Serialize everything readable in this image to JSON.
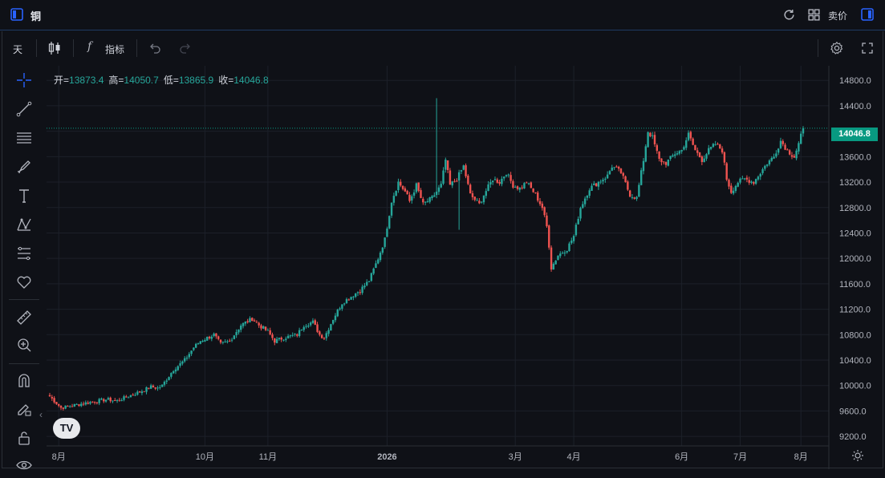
{
  "header": {
    "title": "铜",
    "sell_label": "卖价"
  },
  "toolbar": {
    "interval": "天",
    "indicators_label": "指标",
    "fx_symbol": "f"
  },
  "left_tools": [
    "crosshair-icon",
    "trend-line-icon",
    "horizontal-lines-icon",
    "brush-icon",
    "text-icon",
    "pattern-icon",
    "fib-icon",
    "heart-icon",
    "ruler-icon",
    "zoom-icon",
    "magnet-icon",
    "lock-pencil-icon",
    "lock-icon",
    "eye-icon"
  ],
  "legend": {
    "open_label": "开=",
    "open": "13873.4",
    "high_label": "高=",
    "high": "14050.7",
    "low_label": "低=",
    "low": "13865.9",
    "close_label": "收=",
    "close": "14046.8"
  },
  "colors": {
    "up": "#26a69a",
    "down": "#ef5350",
    "accent": "#2962ff",
    "last_price": "#089981"
  },
  "chart_data": {
    "type": "candlestick",
    "last_price_label": "14046.8",
    "y_ticks": [
      "14800.0",
      "14400.0",
      "14000.0",
      "13600.0",
      "13200.0",
      "12800.0",
      "12400.0",
      "12000.0",
      "11600.0",
      "11200.0",
      "10800.0",
      "10400.0",
      "10000.0",
      "9600.0",
      "9200.0"
    ],
    "y_tick_values": [
      14800,
      14400,
      14000,
      13600,
      13200,
      12800,
      12400,
      12000,
      11600,
      11200,
      10800,
      10400,
      10000,
      9600,
      9200
    ],
    "ylim": [
      9050,
      15030
    ],
    "x_ticks": [
      "8月",
      "10月",
      "11月",
      "2026",
      "3月",
      "4月",
      "6月",
      "7月",
      "8月"
    ],
    "x_tick_index": [
      4,
      69,
      97,
      150,
      207,
      233,
      281,
      307,
      334
    ],
    "anchors": [
      [
        0,
        9830
      ],
      [
        5,
        9650
      ],
      [
        15,
        9720
      ],
      [
        25,
        9780
      ],
      [
        30,
        9760
      ],
      [
        40,
        9900
      ],
      [
        45,
        9980
      ],
      [
        48,
        9960
      ],
      [
        50,
        10000
      ],
      [
        55,
        10250
      ],
      [
        60,
        10400
      ],
      [
        64,
        10600
      ],
      [
        67,
        10700
      ],
      [
        70,
        10750
      ],
      [
        73,
        10800
      ],
      [
        76,
        10650
      ],
      [
        80,
        10700
      ],
      [
        85,
        10950
      ],
      [
        90,
        11050
      ],
      [
        93,
        10950
      ],
      [
        97,
        10850
      ],
      [
        100,
        10700
      ],
      [
        104,
        10750
      ],
      [
        110,
        10800
      ],
      [
        113,
        10950
      ],
      [
        117,
        11000
      ],
      [
        120,
        10800
      ],
      [
        122,
        10750
      ],
      [
        126,
        11050
      ],
      [
        130,
        11300
      ],
      [
        134,
        11400
      ],
      [
        138,
        11500
      ],
      [
        142,
        11650
      ],
      [
        146,
        12000
      ],
      [
        149,
        12300
      ],
      [
        152,
        12900
      ],
      [
        155,
        13200
      ],
      [
        158,
        13050
      ],
      [
        160,
        12900
      ],
      [
        163,
        13150
      ],
      [
        166,
        12850
      ],
      [
        170,
        12950
      ],
      [
        174,
        13150
      ],
      [
        176,
        13550
      ],
      [
        178,
        13150
      ],
      [
        181,
        13250
      ],
      [
        184,
        13450
      ],
      [
        187,
        13000
      ],
      [
        191,
        12850
      ],
      [
        193,
        13000
      ],
      [
        197,
        13250
      ],
      [
        200,
        13200
      ],
      [
        203,
        13350
      ],
      [
        206,
        13150
      ],
      [
        209,
        13100
      ],
      [
        212,
        13200
      ],
      [
        216,
        13000
      ],
      [
        219,
        12800
      ],
      [
        221,
        12500
      ],
      [
        222,
        12200
      ],
      [
        223,
        11850
      ],
      [
        226,
        12050
      ],
      [
        230,
        12150
      ],
      [
        233,
        12350
      ],
      [
        236,
        12800
      ],
      [
        240,
        13100
      ],
      [
        244,
        13200
      ],
      [
        248,
        13300
      ],
      [
        250,
        13450
      ],
      [
        254,
        13350
      ],
      [
        258,
        13000
      ],
      [
        261,
        12950
      ],
      [
        264,
        13550
      ],
      [
        266,
        14000
      ],
      [
        268,
        13900
      ],
      [
        271,
        13550
      ],
      [
        274,
        13500
      ],
      [
        278,
        13650
      ],
      [
        281,
        13700
      ],
      [
        284,
        13950
      ],
      [
        287,
        13700
      ],
      [
        290,
        13550
      ],
      [
        293,
        13700
      ],
      [
        296,
        13800
      ],
      [
        299,
        13700
      ],
      [
        301,
        13250
      ],
      [
        303,
        13050
      ],
      [
        306,
        13200
      ],
      [
        309,
        13250
      ],
      [
        313,
        13200
      ],
      [
        316,
        13350
      ],
      [
        319,
        13500
      ],
      [
        322,
        13600
      ],
      [
        325,
        13850
      ],
      [
        328,
        13700
      ],
      [
        331,
        13600
      ],
      [
        333,
        13800
      ],
      [
        335,
        14046.8
      ]
    ],
    "spikes": [
      [
        172,
        14520
      ],
      [
        182,
        12450
      ]
    ],
    "n_bars": 336
  }
}
